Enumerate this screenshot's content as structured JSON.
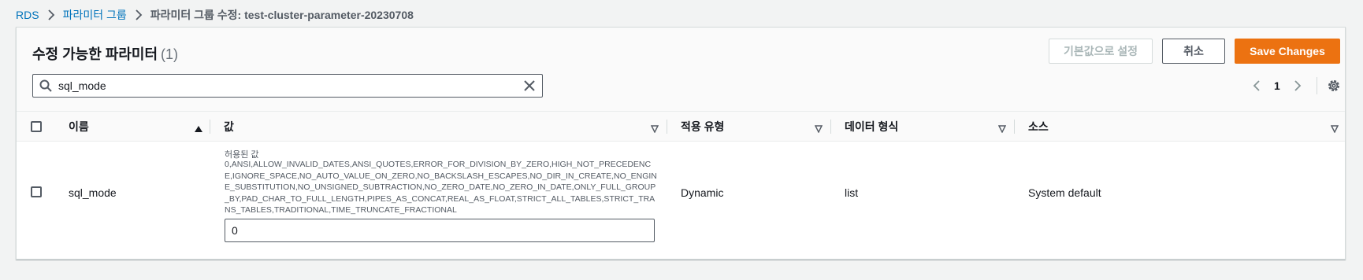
{
  "breadcrumb": {
    "items": [
      "RDS",
      "파라미터 그룹"
    ],
    "current": "파라미터 그룹 수정: test-cluster-parameter-20230708"
  },
  "panel": {
    "title": "수정 가능한 파라미터",
    "count": "(1)"
  },
  "actions": {
    "reset_label": "기본값으로 설정",
    "cancel_label": "취소",
    "save_label": "Save Changes"
  },
  "search": {
    "value": "sql_mode"
  },
  "pagination": {
    "current_page": "1"
  },
  "table": {
    "columns": [
      "이름",
      "값",
      "적용 유형",
      "데이터 형식",
      "소스"
    ],
    "rows": [
      {
        "name": "sql_mode",
        "allowed_label": "허용된 값",
        "allowed_values": "0,ANSI,ALLOW_INVALID_DATES,ANSI_QUOTES,ERROR_FOR_DIVISION_BY_ZERO,HIGH_NOT_PRECEDENCE,IGNORE_SPACE,NO_AUTO_VALUE_ON_ZERO,NO_BACKSLASH_ESCAPES,NO_DIR_IN_CREATE,NO_ENGINE_SUBSTITUTION,NO_UNSIGNED_SUBTRACTION,NO_ZERO_DATE,NO_ZERO_IN_DATE,ONLY_FULL_GROUP_BY,PAD_CHAR_TO_FULL_LENGTH,PIPES_AS_CONCAT,REAL_AS_FLOAT,STRICT_ALL_TABLES,STRICT_TRANS_TABLES,TRADITIONAL,TIME_TRUNCATE_FRACTIONAL",
        "value": "0",
        "apply_type": "Dynamic",
        "data_type": "list",
        "source": "System default"
      }
    ]
  },
  "colors": {
    "link": "#0073bb",
    "primary_button": "#ec7211",
    "background": "#f2f3f3"
  }
}
